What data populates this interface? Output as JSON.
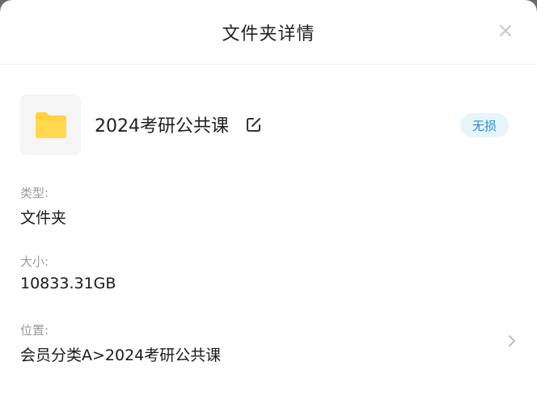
{
  "header": {
    "title": "文件夹详情",
    "close_icon": "close-icon"
  },
  "folder": {
    "name": "2024考研公共课",
    "status_badge": "无损",
    "folder_color": "#FFD23F",
    "edit_icon": "edit-icon"
  },
  "details": {
    "type_label": "类型:",
    "type_value": "文件夹",
    "size_label": "大小:",
    "size_value": "10833.31GB",
    "location_label": "位置:",
    "location_value": "会员分类A>2024考研公共课"
  },
  "colors": {
    "badge_bg": "#e6f5fb",
    "badge_text": "#2a8cc4",
    "label_text": "#9a9a9a"
  }
}
